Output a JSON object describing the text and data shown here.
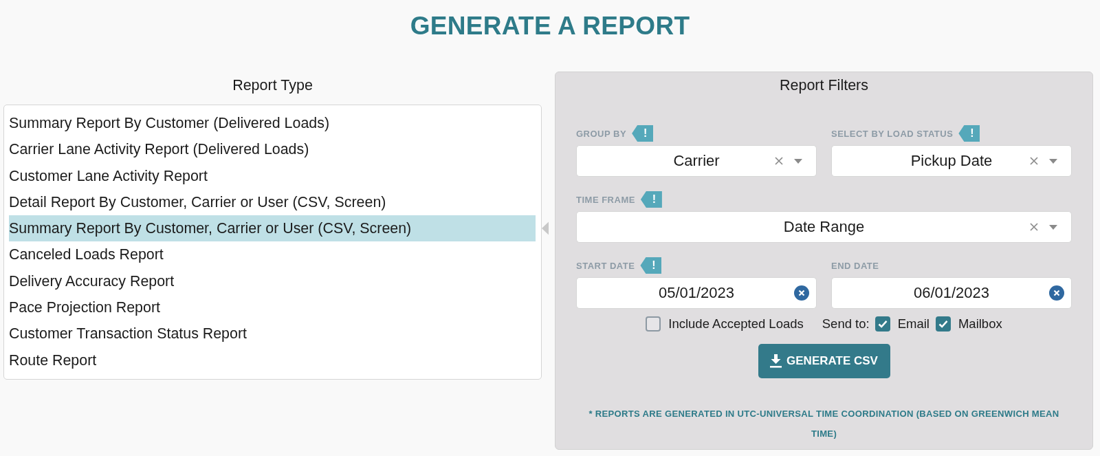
{
  "title": "GENERATE A REPORT",
  "report_type": {
    "heading": "Report Type",
    "items": [
      {
        "label": "Summary Report By Customer (Delivered Loads)",
        "selected": false
      },
      {
        "label": "Carrier Lane Activity Report (Delivered Loads)",
        "selected": false
      },
      {
        "label": "Customer Lane Activity Report",
        "selected": false
      },
      {
        "label": "Detail Report By Customer, Carrier or User (CSV, Screen)",
        "selected": false
      },
      {
        "label": "Summary Report By Customer, Carrier or User (CSV, Screen)",
        "selected": true
      },
      {
        "label": "Canceled Loads Report",
        "selected": false
      },
      {
        "label": "Delivery Accuracy Report",
        "selected": false
      },
      {
        "label": "Pace Projection Report",
        "selected": false
      },
      {
        "label": "Customer Transaction Status Report",
        "selected": false
      },
      {
        "label": "Route Report",
        "selected": false
      }
    ]
  },
  "report_filters": {
    "heading": "Report Filters",
    "field_rows": [
      [
        {
          "label": "GROUP BY",
          "badge": "!",
          "kind": "select",
          "value": "Carrier"
        },
        {
          "label": "SELECT BY LOAD STATUS",
          "badge": "!",
          "kind": "select",
          "value": "Pickup Date"
        }
      ],
      [
        {
          "label": "TIME FRAME",
          "badge": "!",
          "kind": "select",
          "value": "Date Range"
        }
      ],
      [
        {
          "label": "START DATE",
          "badge": "!",
          "kind": "date",
          "value": "05/01/2023"
        },
        {
          "label": "END DATE",
          "kind": "date",
          "value": "06/01/2023"
        }
      ]
    ],
    "include_accepted_loads": {
      "label": "Include Accepted Loads",
      "checked": false
    },
    "send_to": {
      "label": "Send to:",
      "options": [
        {
          "label": "Email",
          "checked": true
        },
        {
          "label": "Mailbox",
          "checked": true
        }
      ]
    },
    "generate_button": {
      "label": "GENERATE CSV"
    },
    "footnote": "* REPORTS ARE GENERATED IN UTC-UNIVERSAL TIME COORDINATION (BASED ON GREENWICH MEAN TIME)"
  }
}
